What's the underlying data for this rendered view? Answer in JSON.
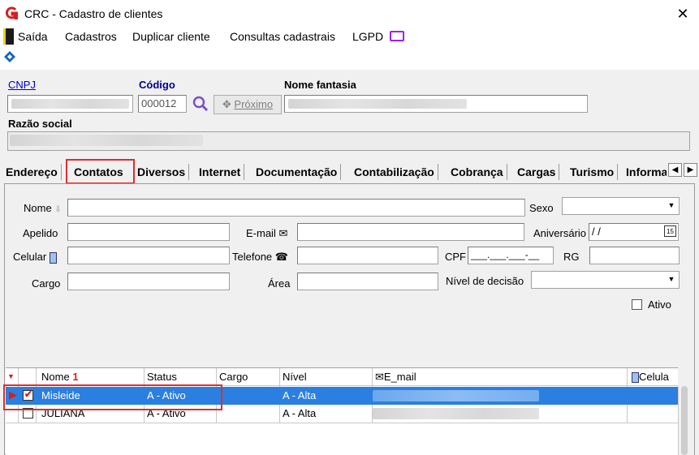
{
  "window": {
    "title": "CRC - Cadastro de clientes",
    "close_glyph": "✕"
  },
  "menu": {
    "items": [
      "Saída",
      "Cadastros",
      "Duplicar cliente",
      "Consultas cadastrais",
      "LGPD"
    ]
  },
  "header": {
    "cnpj_label": "CNPJ",
    "codigo_label": "Código",
    "codigo_value": "000012",
    "next_button": "Próximo",
    "nome_fantasia_label": "Nome fantasia",
    "razao_social_label": "Razão social"
  },
  "tabs": {
    "items": [
      "Endereço",
      "Contatos",
      "Diversos",
      "Internet",
      "Documentação",
      "Contabilização",
      "Cobrança",
      "Cargas",
      "Turismo",
      "Informa"
    ],
    "active": "Contatos"
  },
  "contact_form": {
    "nome_label": "Nome",
    "sexo_label": "Sexo",
    "apelido_label": "Apelido",
    "email_label": "E-mail",
    "aniversario_label": "Aniversário",
    "aniversario_value": "/ /",
    "calendar_glyph": "15",
    "celular_label": "Celular",
    "telefone_label": "Telefone",
    "cpf_label": "CPF",
    "cpf_value": "___.___.___-__",
    "rg_label": "RG",
    "cargo_label": "Cargo",
    "area_label": "Área",
    "nivel_label": "Nível de decisão",
    "ativo_label": "Ativo"
  },
  "grid": {
    "columns": [
      "Nome",
      "Status",
      "Cargo",
      "Nível",
      "E_mail",
      "Celula"
    ],
    "sort_indicator": "1",
    "rows": [
      {
        "checked": true,
        "nome": "Misleide",
        "status": "A - Ativo",
        "cargo": "",
        "nivel": "A - Alta",
        "selected": true
      },
      {
        "checked": false,
        "nome": "JULIANA",
        "status": "A - Ativo",
        "cargo": "",
        "nivel": "A - Alta",
        "selected": false
      }
    ]
  },
  "colors": {
    "selection": "#2a7fe0",
    "highlight": "#d83030",
    "lgpd_icon": "#a020f0",
    "logo": "#d42020"
  }
}
